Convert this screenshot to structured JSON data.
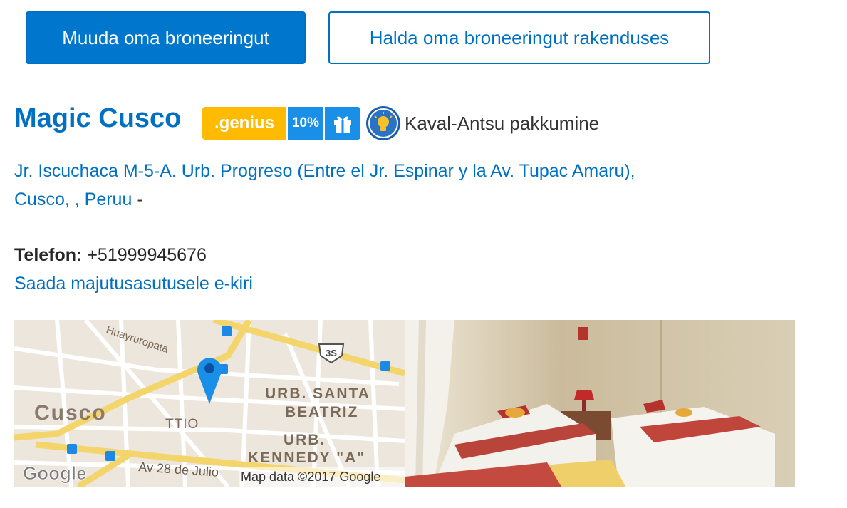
{
  "actions": {
    "change_booking": "Muuda oma broneeringut",
    "manage_in_app": "Halda oma broneeringut rakenduses"
  },
  "property": {
    "name": "Magic Cusco",
    "genius_label": ".genius",
    "discount": "10%",
    "offer_label": "Kaval-Antsu pakkumine",
    "address_line1": "Jr. Iscuchaca M-5-A. Urb. Progreso (Entre el Jr. Espinar y la Av. Tupac Amaru),",
    "address_line2": "Cusco, , Peruu",
    "address_suffix": "-",
    "phone_label": "Telefon:",
    "phone_number": "+51999945676",
    "email_link": "Saada majutusasutusele e-kiri"
  },
  "map": {
    "labels": {
      "huayruropata": "Huayruropata",
      "cusco": "Cusco",
      "ttio": "TTIO",
      "santa_beatriz_1": "URB. SANTA",
      "santa_beatriz_2": "BEATRIZ",
      "kennedy_1": "URB.",
      "kennedy_2": "KENNEDY \"A\"",
      "av28": "Av 28 de Julio",
      "route": "3S"
    },
    "google_logo": "Google",
    "attribution": "Map data ©2017 Google"
  },
  "colors": {
    "brand_blue": "#0071c2",
    "button_blue": "#0077cc",
    "genius_yellow": "#febb02",
    "badge_blue": "#1a8fe8"
  },
  "icons": [
    "gift-icon",
    "lightbulb-icon",
    "map-pin-icon",
    "bus-stop-icon"
  ]
}
